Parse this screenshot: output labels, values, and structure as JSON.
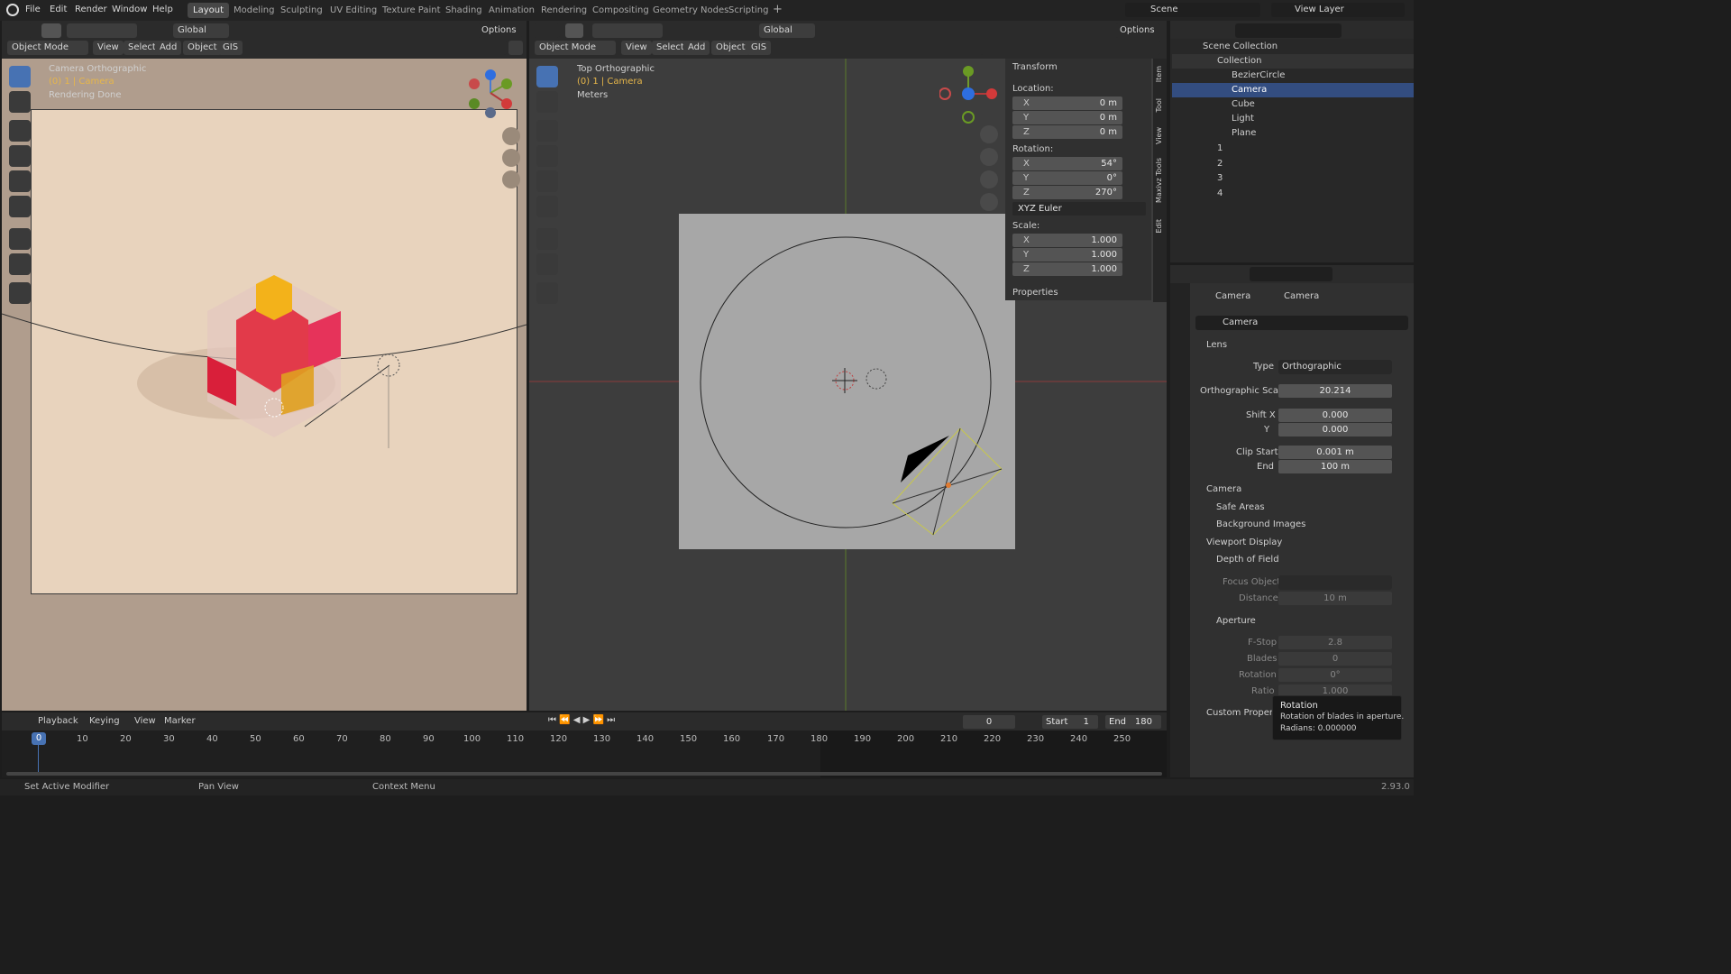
{
  "topbar": {
    "menus": [
      "File",
      "Edit",
      "Render",
      "Window",
      "Help"
    ],
    "workspaces": [
      "Layout",
      "Modeling",
      "Sculpting",
      "UV Editing",
      "Texture Paint",
      "Shading",
      "Animation",
      "Rendering",
      "Compositing",
      "Geometry Nodes",
      "Scripting"
    ],
    "scene": "Scene",
    "view_layer": "View Layer"
  },
  "viewport_left": {
    "mode": "Object Mode",
    "menus": [
      "View",
      "Select",
      "Add",
      "Object",
      "GIS"
    ],
    "orientation": "Global",
    "options": "Options",
    "overlay_title": "Camera Orthographic",
    "overlay_sub": "(0) 1 | Camera",
    "overlay_status": "Rendering Done"
  },
  "viewport_right": {
    "mode": "Object Mode",
    "menus": [
      "View",
      "Select",
      "Add",
      "Object",
      "GIS"
    ],
    "orientation": "Global",
    "options": "Options",
    "overlay_title": "Top Orthographic",
    "overlay_sub": "(0) 1 | Camera",
    "overlay_units": "Meters"
  },
  "npanel": {
    "transform_title": "Transform",
    "location_label": "Location:",
    "location": [
      {
        "axis": "X",
        "value": "0 m"
      },
      {
        "axis": "Y",
        "value": "0 m"
      },
      {
        "axis": "Z",
        "value": "0 m"
      }
    ],
    "rotation_label": "Rotation:",
    "rotation": [
      {
        "axis": "X",
        "value": "54°"
      },
      {
        "axis": "Y",
        "value": "0°"
      },
      {
        "axis": "Z",
        "value": "270°"
      }
    ],
    "rotation_mode": "XYZ Euler",
    "scale_label": "Scale:",
    "scale": [
      {
        "axis": "X",
        "value": "1.000"
      },
      {
        "axis": "Y",
        "value": "1.000"
      },
      {
        "axis": "Z",
        "value": "1.000"
      }
    ],
    "properties_title": "Properties",
    "tabs": [
      "Item",
      "Tool",
      "View",
      "Maxivz Tools",
      "Edit"
    ]
  },
  "outliner": {
    "root": "Scene Collection",
    "collection": "Collection",
    "items": [
      "BezierCircle",
      "Camera",
      "Cube",
      "Light",
      "Plane"
    ],
    "collections": [
      "1",
      "2",
      "3",
      "4"
    ]
  },
  "properties": {
    "breadcrumb_obj": "Camera",
    "breadcrumb_data": "Camera",
    "data_name": "Camera",
    "lens_title": "Lens",
    "type_label": "Type",
    "type_value": "Orthographic",
    "ortho_label": "Orthographic Scale",
    "ortho_value": "20.214",
    "shiftx_label": "Shift X",
    "shiftx_value": "0.000",
    "shifty_label": "Y",
    "shifty_value": "0.000",
    "clipstart_label": "Clip Start",
    "clipstart_value": "0.001 m",
    "clipend_label": "End",
    "clipend_value": "100 m",
    "panels": [
      "Camera",
      "Safe Areas",
      "Background Images",
      "Viewport Display",
      "Depth of Field"
    ],
    "focus_label": "Focus Object",
    "distance_label": "Distance",
    "distance_value": "10 m",
    "aperture_title": "Aperture",
    "fstop_label": "F-Stop",
    "fstop_value": "2.8",
    "blades_label": "Blades",
    "blades_value": "0",
    "rotation_label": "Rotation",
    "rotation_value": "0°",
    "ratio_label": "Ratio",
    "ratio_value": "1.000",
    "custom_props": "Custom Properti"
  },
  "tooltip": {
    "title": "Rotation",
    "desc": "Rotation of blades in aperture.",
    "value": "Radians: 0.000000"
  },
  "timeline": {
    "menus": [
      "Playback",
      "Keying",
      "View",
      "Marker"
    ],
    "current_frame": "0",
    "start_label": "Start",
    "start": "1",
    "end_label": "End",
    "end": "180",
    "ticks": [
      "0",
      "10",
      "20",
      "30",
      "40",
      "50",
      "60",
      "70",
      "80",
      "90",
      "100",
      "110",
      "120",
      "130",
      "140",
      "150",
      "160",
      "170",
      "180",
      "190",
      "200",
      "210",
      "220",
      "230",
      "240",
      "250"
    ]
  },
  "statusbar": {
    "left": "Set Active Modifier",
    "mid": "Pan View",
    "right": "Context Menu",
    "version": "2.93.0"
  },
  "colors": {
    "accent": "#4772b3",
    "selection": "#e0b060",
    "cube_red": "#d8203a",
    "cube_yellow": "#f0b010"
  }
}
